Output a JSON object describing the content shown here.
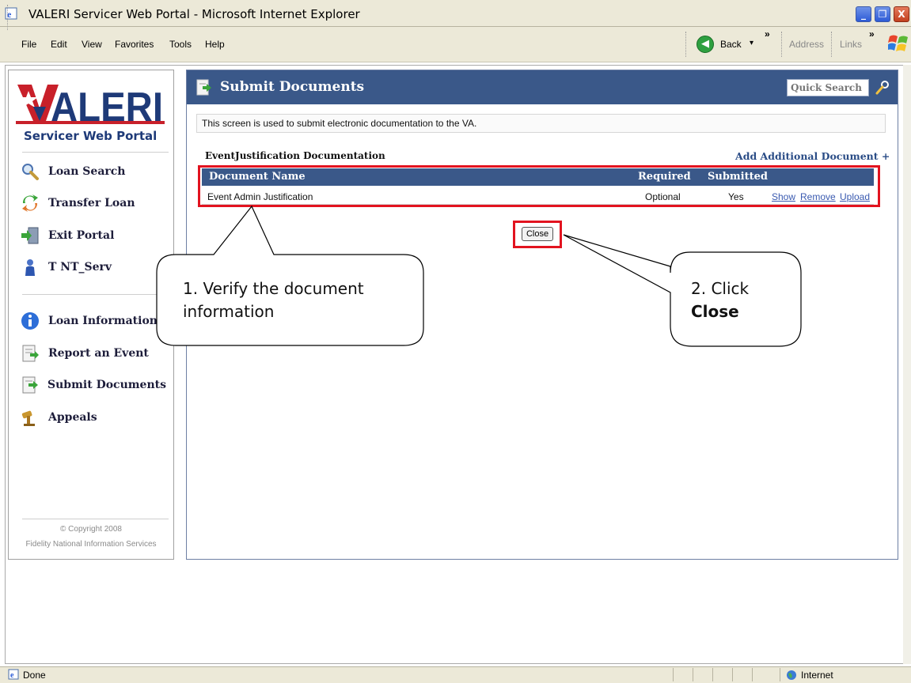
{
  "window": {
    "title": "VALERI Servicer Web Portal - Microsoft Internet Explorer",
    "minimize_glyph": "_",
    "restore_glyph": "❐",
    "close_glyph": "X"
  },
  "menu": {
    "items": [
      "File",
      "Edit",
      "View",
      "Favorites",
      "Tools",
      "Help"
    ],
    "back_label": "Back",
    "back_dropdown": "▾",
    "chevron": "»",
    "address_label": "Address",
    "links_label": "Links"
  },
  "sidebar": {
    "logo_text": "VALERI",
    "logo_subtitle": "Servicer Web Portal",
    "top_items": [
      {
        "label": "Loan Search",
        "icon": "magnifier-icon"
      },
      {
        "label": "Transfer Loan",
        "icon": "transfer-arrows-icon"
      },
      {
        "label": "Exit Portal",
        "icon": "exit-door-icon"
      },
      {
        "label": "T NT_Serv",
        "icon": "user-icon"
      }
    ],
    "bottom_items": [
      {
        "label": "Loan Information",
        "icon": "info-icon"
      },
      {
        "label": "Report an Event",
        "icon": "report-document-icon"
      },
      {
        "label": "Submit Documents",
        "icon": "submit-document-icon"
      },
      {
        "label": "Appeals",
        "icon": "gavel-icon"
      }
    ],
    "copyright_line1": "© Copyright 2008",
    "copyright_line2": "Fidelity National Information Services"
  },
  "main": {
    "title": "Submit Documents",
    "quick_search_placeholder": "Quick Search",
    "info_text": "This screen is used to submit electronic documentation to the VA.",
    "section_title": "EventJustification Documentation",
    "add_document_label": "Add Additional Document +",
    "table": {
      "headers": [
        "Document Name",
        "Required",
        "Submitted"
      ],
      "rows": [
        {
          "document_name": "Event Admin Justification",
          "required": "Optional",
          "submitted": "Yes",
          "actions": [
            "Show",
            "Remove",
            "Upload"
          ]
        }
      ]
    },
    "close_button": "Close"
  },
  "callouts": {
    "step1": "1. Verify the document information",
    "step2_prefix": "2. Click",
    "step2_bold": "Close"
  },
  "status": {
    "left": "Done",
    "right": "Internet"
  },
  "colors": {
    "header_blue": "#3a5889",
    "highlight_red": "#e2131f",
    "logo_red": "#c8202a",
    "logo_navy": "#1e3a78"
  }
}
